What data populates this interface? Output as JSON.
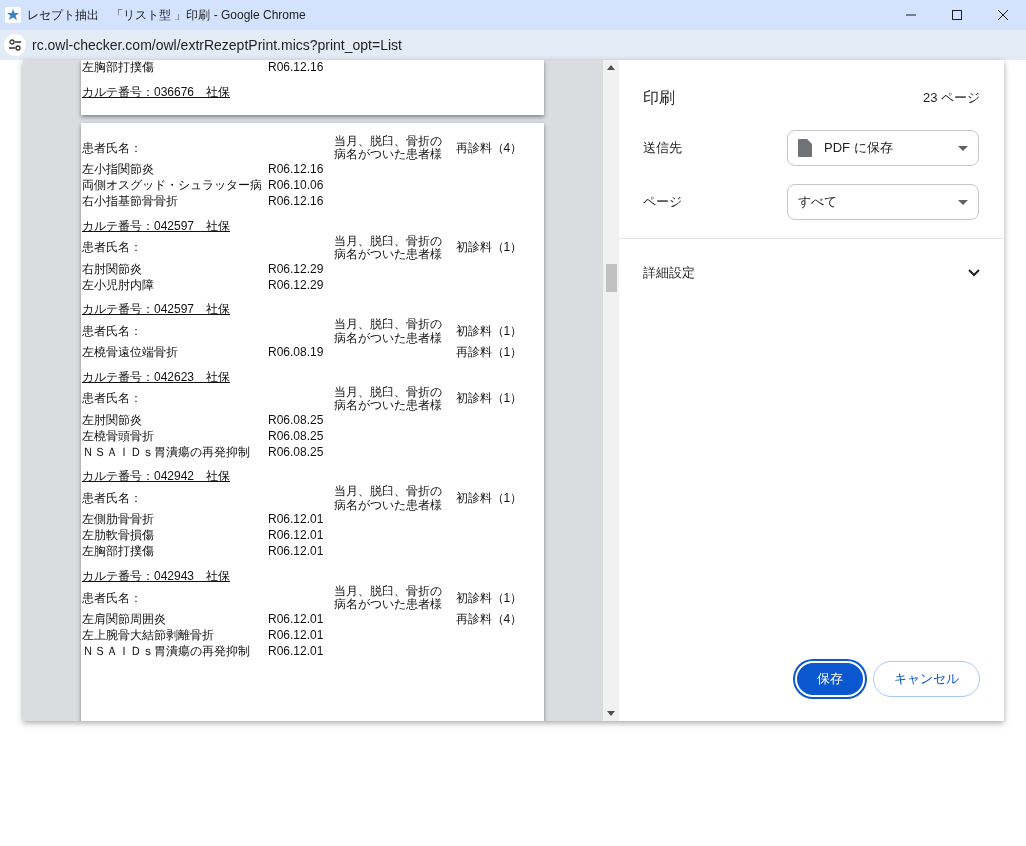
{
  "window": {
    "title": "レセプト抽出　「リスト型 」印刷 - Google Chrome",
    "url": "rc.owl-checker.com/owl/extrRezeptPrint.mics?print_opt=List"
  },
  "preview": {
    "pages": [
      {
        "blocks": [
          {
            "kind": "disease",
            "name": "左胸部打撲傷",
            "date": "R06.12.16"
          },
          {
            "kind": "header",
            "text": "カルテ番号：036676　社保"
          }
        ]
      },
      {
        "blocks": [
          {
            "kind": "patient",
            "label": "患者氏名：",
            "note": "当月、脱臼、骨折の病名がついた患者様",
            "fee": "再診料（4）"
          },
          {
            "kind": "disease",
            "name": "左小指関節炎",
            "date": "R06.12.16"
          },
          {
            "kind": "disease",
            "name": "両側オスグッド・シュラッター病",
            "date": "R06.10.06"
          },
          {
            "kind": "disease",
            "name": "右小指基節骨骨折",
            "date": "R06.12.16"
          },
          {
            "kind": "header",
            "text": "カルテ番号：042597　社保"
          },
          {
            "kind": "patient",
            "label": "患者氏名：",
            "note": "当月、脱臼、骨折の病名がついた患者様",
            "fee": "初診料（1）"
          },
          {
            "kind": "disease",
            "name": "右肘関節炎",
            "date": "R06.12.29"
          },
          {
            "kind": "disease",
            "name": "左小児肘内障",
            "date": "R06.12.29"
          },
          {
            "kind": "header",
            "text": "カルテ番号：042597　社保"
          },
          {
            "kind": "patient",
            "label": "患者氏名：",
            "note": "当月、脱臼、骨折の病名がついた患者様",
            "fee": "初診料（1）"
          },
          {
            "kind": "disease",
            "name": "左橈骨遠位端骨折",
            "date": "R06.08.19",
            "fee": "再診料（1）"
          },
          {
            "kind": "header",
            "text": "カルテ番号：042623　社保"
          },
          {
            "kind": "patient",
            "label": "患者氏名：",
            "note": "当月、脱臼、骨折の病名がついた患者様",
            "fee": "初診料（1）"
          },
          {
            "kind": "disease",
            "name": "左肘関節炎",
            "date": "R06.08.25"
          },
          {
            "kind": "disease",
            "name": "左橈骨頭骨折",
            "date": "R06.08.25"
          },
          {
            "kind": "disease",
            "name": "ＮＳＡＩＤｓ胃潰瘍の再発抑制",
            "date": "R06.08.25"
          },
          {
            "kind": "header",
            "text": "カルテ番号：042942　社保"
          },
          {
            "kind": "patient",
            "label": "患者氏名：",
            "note": "当月、脱臼、骨折の病名がついた患者様",
            "fee": "初診料（1）"
          },
          {
            "kind": "disease",
            "name": "左側肋骨骨折",
            "date": "R06.12.01"
          },
          {
            "kind": "disease",
            "name": "左肋軟骨損傷",
            "date": "R06.12.01"
          },
          {
            "kind": "disease",
            "name": "左胸部打撲傷",
            "date": "R06.12.01"
          },
          {
            "kind": "header",
            "text": "カルテ番号：042943　社保"
          },
          {
            "kind": "patient",
            "label": "患者氏名：",
            "note": "当月、脱臼、骨折の病名がついた患者様",
            "fee": "初診料（1）"
          },
          {
            "kind": "disease",
            "name": "左肩関節周囲炎",
            "date": "R06.12.01",
            "fee": "再診料（4）"
          },
          {
            "kind": "disease",
            "name": "左上腕骨大結節剥離骨折",
            "date": "R06.12.01"
          },
          {
            "kind": "disease",
            "name": "ＮＳＡＩＤｓ胃潰瘍の再発抑制",
            "date": "R06.12.01"
          }
        ]
      }
    ]
  },
  "print_panel": {
    "title": "印刷",
    "page_count": "23 ページ",
    "settings": [
      {
        "label": "送信先",
        "value": "PDF に保存",
        "kind": "destination"
      },
      {
        "label": "ページ",
        "value": "すべて",
        "kind": "plain"
      }
    ],
    "more_settings": {
      "label": "詳細設定",
      "expanded": false
    },
    "buttons": [
      {
        "label": "保存",
        "kind": "primary"
      },
      {
        "label": "キャンセル",
        "kind": "secondary"
      }
    ]
  }
}
